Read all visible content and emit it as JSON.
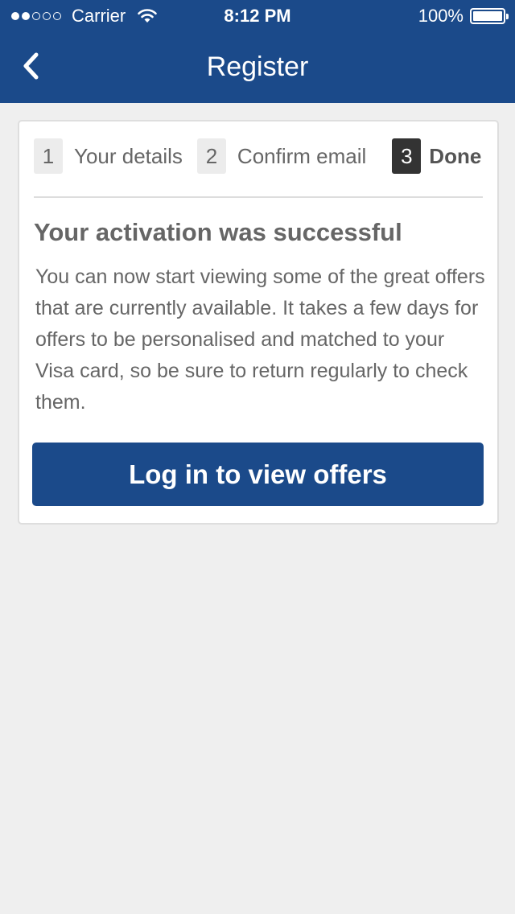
{
  "status_bar": {
    "carrier": "Carrier",
    "time": "8:12 PM",
    "battery": "100%",
    "signal_filled": 2,
    "signal_total": 5
  },
  "nav": {
    "title": "Register",
    "back_icon": "chevron-left-icon"
  },
  "steps": [
    {
      "number": "1",
      "label": "Your details",
      "active": false
    },
    {
      "number": "2",
      "label": "Confirm email",
      "active": false
    },
    {
      "number": "3",
      "label": "Done",
      "active": true
    }
  ],
  "content": {
    "title": "Your activation was successful",
    "body": "You can now start viewing some of the great offers that are currently available. It takes a few days for offers to be personalised and matched to your Visa card, so be sure to return regularly to check them.",
    "button_label": "Log in to view offers"
  },
  "colors": {
    "brand": "#1b4a8a",
    "background": "#efefef",
    "active_step": "#333333"
  }
}
